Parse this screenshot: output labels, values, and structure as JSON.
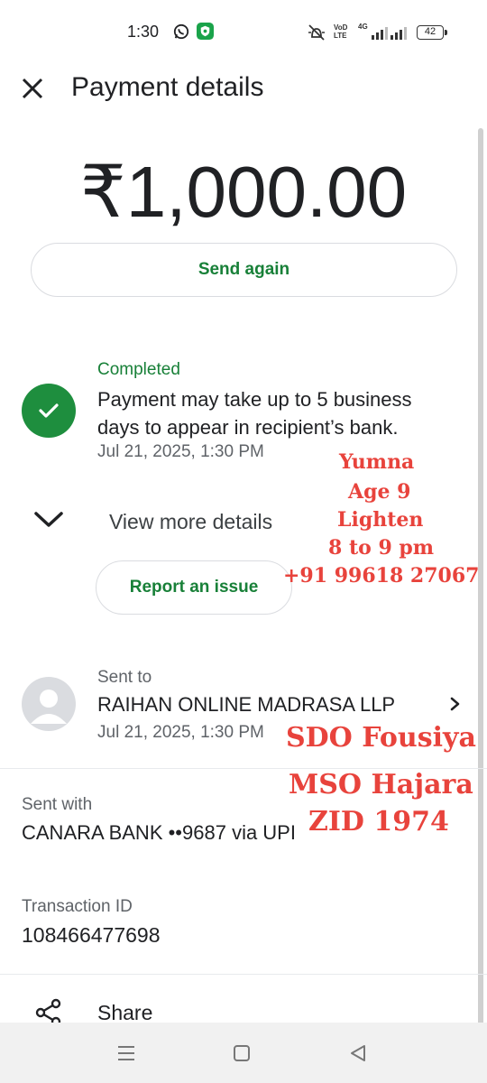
{
  "status_bar": {
    "time": "1:30",
    "volte_line1": "VoD",
    "volte_line2": "LTE",
    "network": "4G",
    "battery": "42"
  },
  "header": {
    "title": "Payment details"
  },
  "payment": {
    "amount": "₹1,000.00",
    "send_again_label": "Send again",
    "status_label": "Completed",
    "status_message": "Payment may take up to 5 business days to appear in recipient’s bank.",
    "date": "Jul 21, 2025, 1:30 PM",
    "view_more_label": "View more details",
    "report_issue_label": "Report an issue"
  },
  "recipient": {
    "sent_to_label": "Sent to",
    "name": "RAIHAN ONLINE MADRASA LLP",
    "date": "Jul 21, 2025, 1:30 PM"
  },
  "sent_with": {
    "label": "Sent with",
    "value": "CANARA BANK ••9687 via UPI"
  },
  "transaction": {
    "label": "Transaction ID",
    "value": "108466477698"
  },
  "share": {
    "label": "Share"
  },
  "overlay_notes": {
    "line1": "Yumna",
    "line2": "Age 9",
    "line3": "Lighten",
    "line4": "8 to 9 pm",
    "line5": "+91 99618 27067",
    "line6": "SDO Fousiya",
    "line7": "MSO Hajara",
    "line8": "ZID 1974"
  },
  "colors": {
    "accent_green": "#188038",
    "check_green": "#1e8e3e",
    "overlay_red": "#e8433c"
  },
  "icons": {
    "close": "close-icon",
    "check": "check-icon",
    "chevron": "chevron-down-icon",
    "arrow": "chevron-right-icon",
    "share": "share-icon"
  }
}
